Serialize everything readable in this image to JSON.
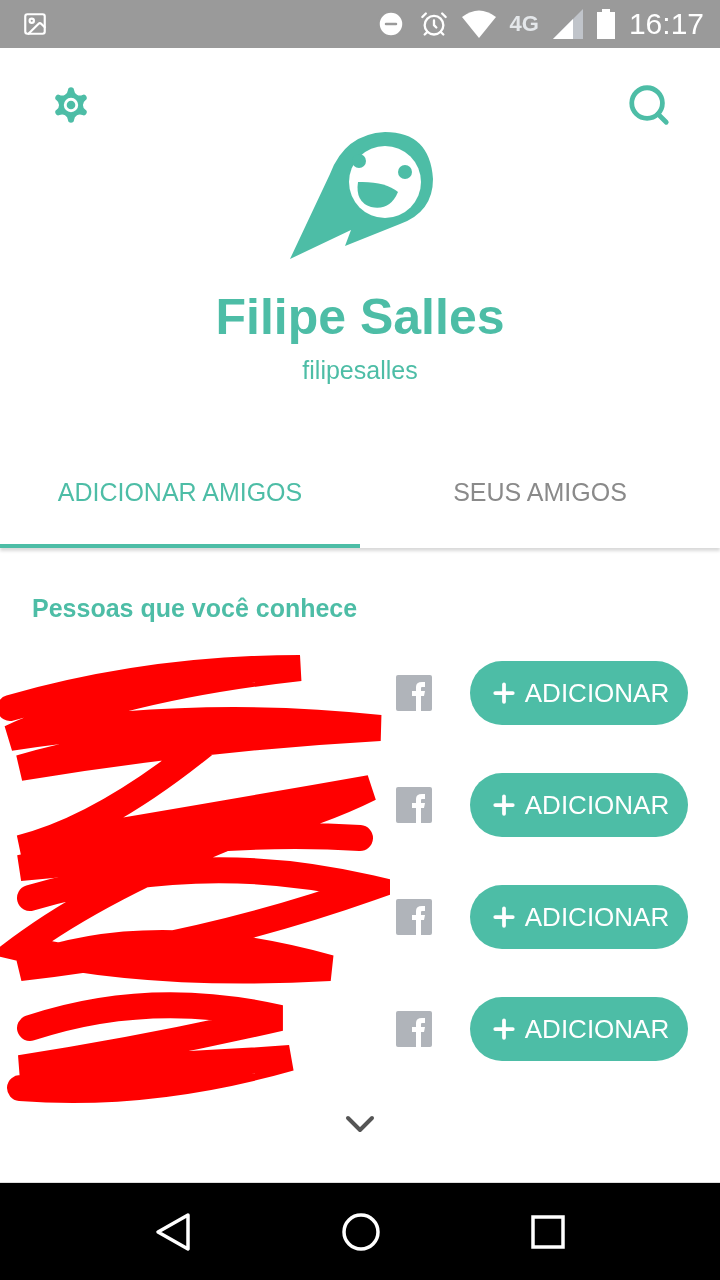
{
  "status_bar": {
    "network": "4G",
    "time": "16:17"
  },
  "profile": {
    "name": "Filipe Salles",
    "username": "filipesalles"
  },
  "tabs": [
    {
      "label": "ADICIONAR AMIGOS",
      "selected": true
    },
    {
      "label": "SEUS AMIGOS",
      "selected": false
    }
  ],
  "section_title": "Pessoas que você conhece",
  "people": [
    {
      "button": "ADICIONAR"
    },
    {
      "button": "ADICIONAR"
    },
    {
      "button": "ADICIONAR"
    },
    {
      "button": "ADICIONAR"
    }
  ]
}
